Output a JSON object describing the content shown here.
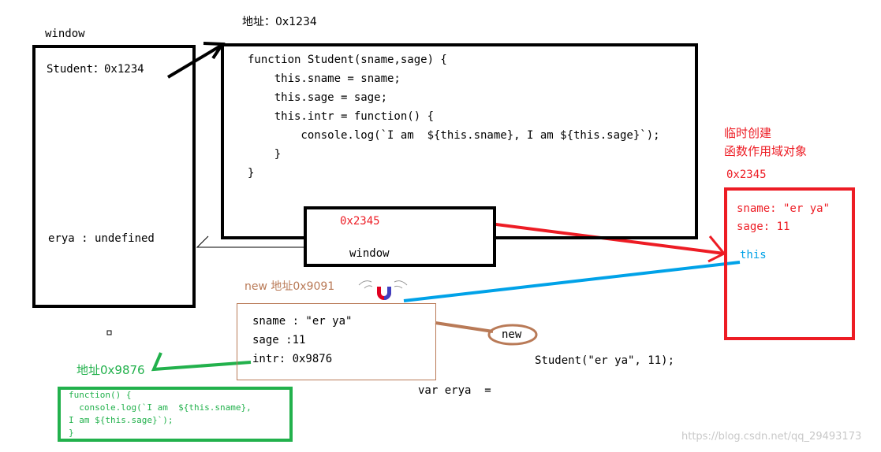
{
  "window_frame": {
    "label": "window",
    "student": "Student：0x1234",
    "erya": "erya : undefined"
  },
  "function_frame": {
    "address": "地址：0x1234",
    "code": [
      "function Student(sname,sage) {",
      "    this.sname = sname;",
      "    this.sage = sage;",
      "    this.intr = function() {",
      "        console.log(`I am  ${this.sname}, I am ${this.sage}`);",
      "    }",
      "}"
    ]
  },
  "this_box": {
    "address": "0x2345",
    "target": "window"
  },
  "scope_object": {
    "caption_line1": "临时创建",
    "caption_line2": "函数作用域对象",
    "address": "0x2345",
    "sname": "sname: \"er ya\"",
    "sage": "sage: 11",
    "this_label": "this"
  },
  "new_object": {
    "address": "new 地址0x9091",
    "fields": [
      "sname : \"er ya\"",
      "sage :11",
      "intr: 0x9876"
    ]
  },
  "new_keyword": "new",
  "call_expr": "Student(\"er ya\", 11);",
  "var_decl": "var erya  =",
  "intr_function": {
    "address": "地址0x9876",
    "code": [
      "function() {",
      "  console.log(`I am  ${this.sname},",
      "I am ${this.sage}`);",
      "}"
    ]
  },
  "watermark": "https://blog.csdn.net/qq_29493173",
  "colors": {
    "black": "#000000",
    "red": "#ed1c24",
    "blue": "#00a2e8",
    "brown": "#b97a57",
    "green": "#22b14c"
  }
}
